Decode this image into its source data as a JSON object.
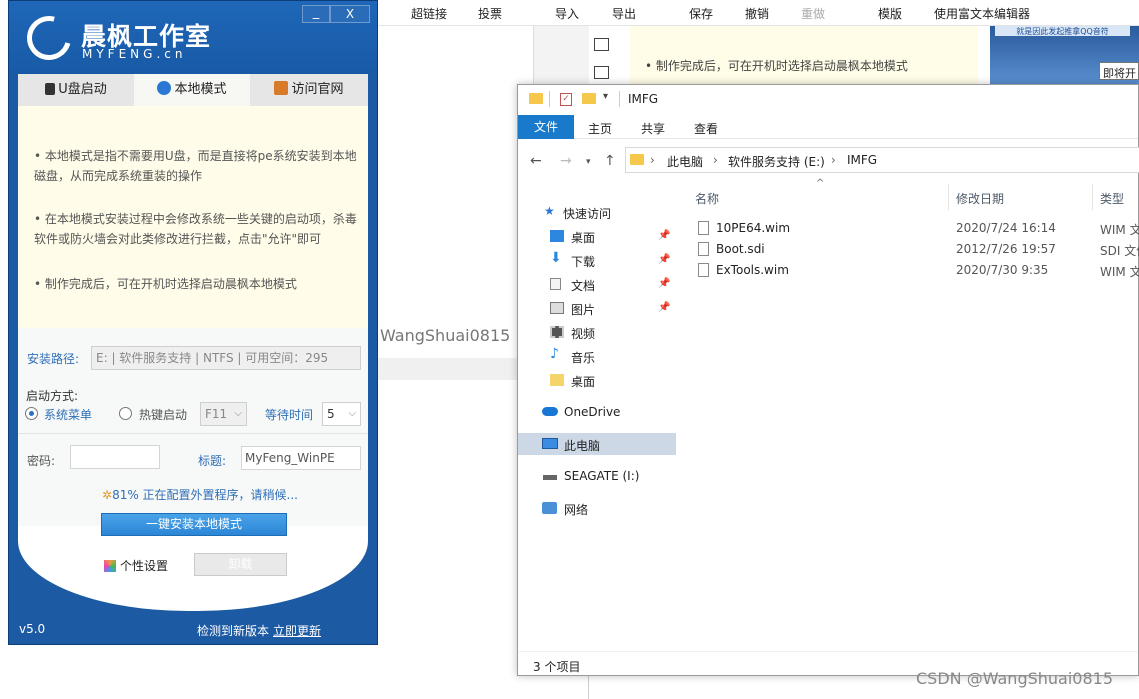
{
  "editor": {
    "toolbar": [
      "超链接",
      "投票",
      "导入",
      "导出",
      "保存",
      "撤销",
      "重做",
      "模版",
      "使用富文本编辑器"
    ],
    "doc_text": "• 制作完成后，可在开机时选择启动晨枫本地模式",
    "tooltip": "即将开",
    "watermark_mid": "WangShuai0815",
    "image_banner": "就是因此发起推拿QQ音符"
  },
  "explorer": {
    "title": "IMFG",
    "ribbon": [
      "文件",
      "主页",
      "共享",
      "查看"
    ],
    "breadcrumb": [
      "此电脑",
      "软件服务支持 (E:)",
      "IMFG"
    ],
    "nav": [
      {
        "label": "快速访问",
        "pin": false,
        "icon": "star-icon"
      },
      {
        "label": "桌面",
        "pin": true,
        "icon": "desktop-icon"
      },
      {
        "label": "下载",
        "pin": true,
        "icon": "download-icon"
      },
      {
        "label": "文档",
        "pin": true,
        "icon": "document-icon"
      },
      {
        "label": "图片",
        "pin": true,
        "icon": "picture-icon"
      },
      {
        "label": "视频",
        "pin": false,
        "icon": "video-icon"
      },
      {
        "label": "音乐",
        "pin": false,
        "icon": "music-icon"
      },
      {
        "label": "桌面",
        "pin": false,
        "icon": "folder-icon"
      },
      {
        "label": "OneDrive",
        "pin": false,
        "icon": "cloud-icon"
      },
      {
        "label": "此电脑",
        "pin": false,
        "icon": "computer-icon"
      },
      {
        "label": "SEAGATE (I:)",
        "pin": false,
        "icon": "drive-icon"
      },
      {
        "label": "网络",
        "pin": false,
        "icon": "network-icon"
      }
    ],
    "columns": {
      "name": "名称",
      "date": "修改日期",
      "type": "类型"
    },
    "files": [
      {
        "name": "10PE64.wim",
        "date": "2020/7/24 16:14",
        "type": "WIM 文"
      },
      {
        "name": "Boot.sdi",
        "date": "2012/7/26 19:57",
        "type": "SDI 文件"
      },
      {
        "name": "ExTools.wim",
        "date": "2020/7/30 9:35",
        "type": "WIM 文"
      }
    ],
    "status": "3 个项目"
  },
  "myfeng": {
    "title": "晨枫工作室",
    "subtitle": "MYFENG.cn",
    "min_label": "_",
    "close_label": "X",
    "tabs": [
      "U盘启动",
      "本地模式",
      "访问官网"
    ],
    "info": [
      "• 本地模式是指不需要用U盘，而是直接将pe系统安装到本地磁盘，从而完成系统重装的操作",
      "• 在本地模式安装过程中会修改系统一些关键的启动项，杀毒软件或防火墙会对此类修改进行拦截，点击\"允许\"即可",
      "• 制作完成后，可在开机时选择启动晨枫本地模式"
    ],
    "install_path_label": "安装路径:",
    "install_path_value": "E: | 软件服务支持 | NTFS | 可用空间：295",
    "boot_mode_label": "启动方式:",
    "radio_system_menu": "系统菜单",
    "radio_hotkey": "热键启动",
    "hotkey_value": "F11",
    "wait_label": "等待时间",
    "wait_value": "5",
    "password_label": "密码:",
    "password_value": "",
    "caption_label": "标题:",
    "caption_value": "MyFeng_WinPE",
    "progress_percent": 81,
    "progress_text": "81% 正在配置外置程序，请稍候...",
    "install_button": "一键安装本地模式",
    "personal_label": "个性设置",
    "uninstall_button": "卸载",
    "version": "v5.0",
    "update_text": "检测到新版本",
    "update_link": "立即更新"
  },
  "watermark": "CSDN @WangShuai0815"
}
